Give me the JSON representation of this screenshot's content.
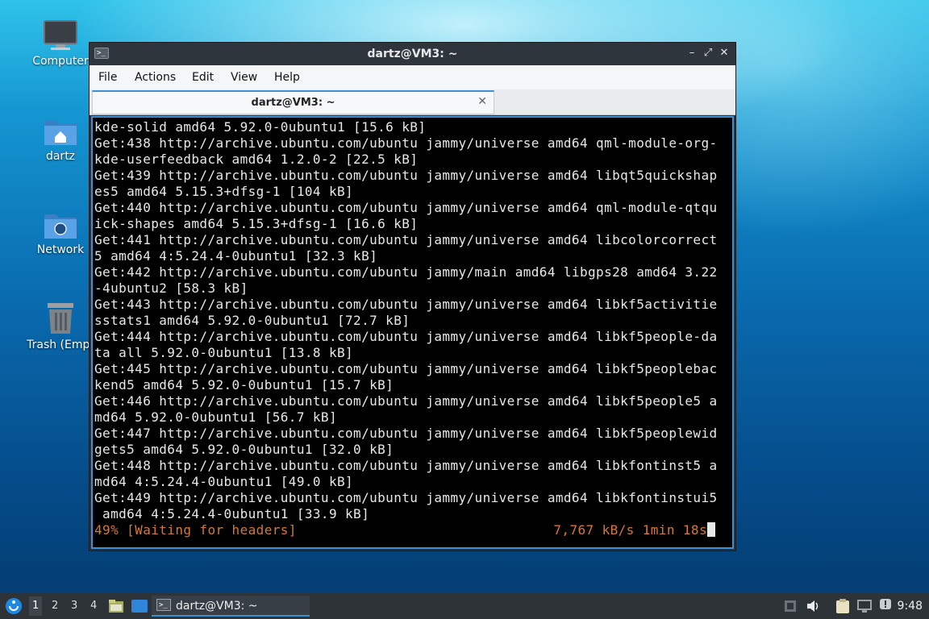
{
  "desktop": {
    "icons": [
      {
        "label": "Computer",
        "icon": "monitor-icon"
      },
      {
        "label": "dartz",
        "icon": "home-folder-icon"
      },
      {
        "label": "Network",
        "icon": "network-folder-icon"
      },
      {
        "label": "Trash (Empt",
        "icon": "trash-icon"
      }
    ]
  },
  "window": {
    "title": "dartz@VM3: ~",
    "controls": {
      "minimize": "–",
      "maximize": "⤢",
      "close": "✕"
    },
    "menu": [
      "File",
      "Actions",
      "Edit",
      "View",
      "Help"
    ],
    "tab": {
      "label": "dartz@VM3: ~",
      "close": "✕"
    }
  },
  "terminal": {
    "lines": [
      "kde-solid amd64 5.92.0-0ubuntu1 [15.6 kB]",
      "Get:438 http://archive.ubuntu.com/ubuntu jammy/universe amd64 qml-module-org-",
      "kde-userfeedback amd64 1.2.0-2 [22.5 kB]",
      "Get:439 http://archive.ubuntu.com/ubuntu jammy/universe amd64 libqt5quickshap",
      "es5 amd64 5.15.3+dfsg-1 [104 kB]",
      "Get:440 http://archive.ubuntu.com/ubuntu jammy/universe amd64 qml-module-qtqu",
      "ick-shapes amd64 5.15.3+dfsg-1 [16.6 kB]",
      "Get:441 http://archive.ubuntu.com/ubuntu jammy/universe amd64 libcolorcorrect",
      "5 amd64 4:5.24.4-0ubuntu1 [32.3 kB]",
      "Get:442 http://archive.ubuntu.com/ubuntu jammy/main amd64 libgps28 amd64 3.22",
      "-4ubuntu2 [58.3 kB]",
      "Get:443 http://archive.ubuntu.com/ubuntu jammy/universe amd64 libkf5activitie",
      "sstats1 amd64 5.92.0-0ubuntu1 [72.7 kB]",
      "Get:444 http://archive.ubuntu.com/ubuntu jammy/universe amd64 libkf5people-da",
      "ta all 5.92.0-0ubuntu1 [13.8 kB]",
      "Get:445 http://archive.ubuntu.com/ubuntu jammy/universe amd64 libkf5peoplebac",
      "kend5 amd64 5.92.0-0ubuntu1 [15.7 kB]",
      "Get:446 http://archive.ubuntu.com/ubuntu jammy/universe amd64 libkf5people5 a",
      "md64 5.92.0-0ubuntu1 [56.7 kB]",
      "Get:447 http://archive.ubuntu.com/ubuntu jammy/universe amd64 libkf5peoplewid",
      "gets5 amd64 5.92.0-0ubuntu1 [32.0 kB]",
      "Get:448 http://archive.ubuntu.com/ubuntu jammy/universe amd64 libkfontinst5 a",
      "md64 4:5.24.4-0ubuntu1 [49.0 kB]",
      "Get:449 http://archive.ubuntu.com/ubuntu jammy/universe amd64 libkfontinstui5",
      " amd64 4:5.24.4-0ubuntu1 [33.9 kB]"
    ],
    "status_left": "49% [Waiting for headers]",
    "status_right": "7,767 kB/s 1min 18s",
    "status_color": "#d4783c"
  },
  "taskbar": {
    "workspaces": [
      "1",
      "2",
      "3",
      "4"
    ],
    "active_workspace": "1",
    "task_label": "dartz@VM3: ~",
    "clock": "9:48",
    "accent": "#3d8fd1"
  }
}
